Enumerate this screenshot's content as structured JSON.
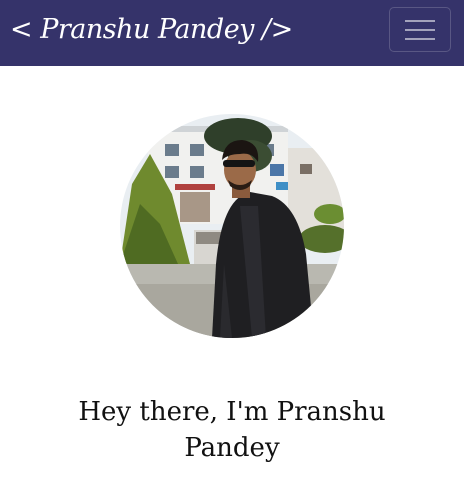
{
  "navbar": {
    "brand_text": "< Pranshu Pandey />",
    "background": "#35336a",
    "toggler_icon": "hamburger-menu-icon"
  },
  "hero": {
    "avatar_description": "circular-profile-photo",
    "heading": "Hey there, I'm Pranshu Pandey"
  }
}
